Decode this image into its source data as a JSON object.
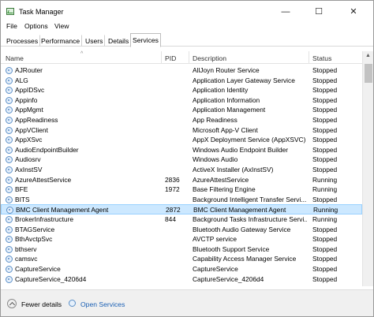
{
  "window": {
    "title": "Task Manager",
    "controls": {
      "minimize": "—",
      "maximize": "☐",
      "close": "✕"
    }
  },
  "menu": [
    "File",
    "Options",
    "View"
  ],
  "tabs": [
    "Processes",
    "Performance",
    "Users",
    "Details",
    "Services"
  ],
  "active_tab": "Services",
  "columns": {
    "name": "Name",
    "pid": "PID",
    "description": "Description",
    "status": "Status"
  },
  "rows": [
    {
      "name": "AJRouter",
      "pid": "",
      "description": "AllJoyn Router Service",
      "status": "Stopped"
    },
    {
      "name": "ALG",
      "pid": "",
      "description": "Application Layer Gateway Service",
      "status": "Stopped"
    },
    {
      "name": "AppIDSvc",
      "pid": "",
      "description": "Application Identity",
      "status": "Stopped"
    },
    {
      "name": "Appinfo",
      "pid": "",
      "description": "Application Information",
      "status": "Stopped"
    },
    {
      "name": "AppMgmt",
      "pid": "",
      "description": "Application Management",
      "status": "Stopped"
    },
    {
      "name": "AppReadiness",
      "pid": "",
      "description": "App Readiness",
      "status": "Stopped"
    },
    {
      "name": "AppVClient",
      "pid": "",
      "description": "Microsoft App-V Client",
      "status": "Stopped"
    },
    {
      "name": "AppXSvc",
      "pid": "",
      "description": "AppX Deployment Service (AppXSVC)",
      "status": "Stopped"
    },
    {
      "name": "AudioEndpointBuilder",
      "pid": "",
      "description": "Windows Audio Endpoint Builder",
      "status": "Stopped"
    },
    {
      "name": "Audiosrv",
      "pid": "",
      "description": "Windows Audio",
      "status": "Stopped"
    },
    {
      "name": "AxInstSV",
      "pid": "",
      "description": "ActiveX Installer (AxInstSV)",
      "status": "Stopped"
    },
    {
      "name": "AzureAttestService",
      "pid": "2836",
      "description": "AzureAttestService",
      "status": "Running"
    },
    {
      "name": "BFE",
      "pid": "1972",
      "description": "Base Filtering Engine",
      "status": "Running"
    },
    {
      "name": "BITS",
      "pid": "",
      "description": "Background Intelligent Transfer Servi...",
      "status": "Stopped"
    },
    {
      "name": "BMC Client Management Agent",
      "pid": "2872",
      "description": "BMC Client Management Agent",
      "status": "Running",
      "selected": true
    },
    {
      "name": "BrokerInfrastructure",
      "pid": "844",
      "description": "Background Tasks Infrastructure Servi...",
      "status": "Running"
    },
    {
      "name": "BTAGService",
      "pid": "",
      "description": "Bluetooth Audio Gateway Service",
      "status": "Stopped"
    },
    {
      "name": "BthAvctpSvc",
      "pid": "",
      "description": "AVCTP service",
      "status": "Stopped"
    },
    {
      "name": "bthserv",
      "pid": "",
      "description": "Bluetooth Support Service",
      "status": "Stopped"
    },
    {
      "name": "camsvc",
      "pid": "",
      "description": "Capability Access Manager Service",
      "status": "Stopped"
    },
    {
      "name": "CaptureService",
      "pid": "",
      "description": "CaptureService",
      "status": "Stopped"
    },
    {
      "name": "CaptureService_4206d4",
      "pid": "",
      "description": "CaptureService_4206d4",
      "status": "Stopped"
    }
  ],
  "footer": {
    "fewer_details": "Fewer details",
    "open_services": "Open Services"
  },
  "colors": {
    "selection_bg": "#cce8ff",
    "selection_border": "#99d1ff",
    "link": "#1a5fb4"
  }
}
